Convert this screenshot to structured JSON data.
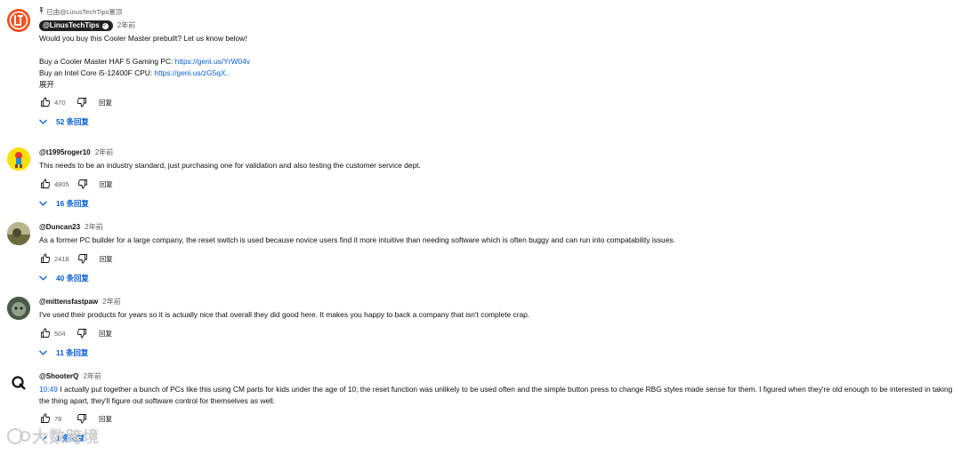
{
  "comments": [
    {
      "pinned_label": "已由@LinusTechTips置顶",
      "author": "@LinusTechTips",
      "time": "2年前",
      "lines": [
        "Would you buy this Cooler Master prebuilt? Let us know below!",
        "",
        "Buy a Cooler Master HAF 5 Gaming PC: ",
        "Buy an Intel Core i5-12400F CPU: "
      ],
      "links": [
        "https://geni.us/YrW04v",
        "https://geni.us/zG5qX.."
      ],
      "expand_label": "展开",
      "likes": "470",
      "reply_label": "回复",
      "replies_label": "52 条回复",
      "avatar_color": "#f4511e"
    },
    {
      "author": "@t1995roger10",
      "time": "2年前",
      "text": "This needs to be an industry standard, just purchasing one for validation and also testing the customer service dept.",
      "likes": "4805",
      "reply_label": "回复",
      "replies_label": "16 条回复",
      "avatar_color": "#f6e000"
    },
    {
      "author": "@Duncan23",
      "time": "2年前",
      "text": "As a former PC builder for a large company, the reset switch is used because novice users find it more intuitive than needing software which is often buggy and can run into compatability issues.",
      "likes": "2418",
      "reply_label": "回复",
      "replies_label": "40 条回复",
      "avatar_color": "#8a8a5c"
    },
    {
      "author": "@mittensfastpaw",
      "time": "2年前",
      "text": "I've used their products for years so it is actually nice that overall they did good here. It makes you happy to back a company that isn't complete crap.",
      "likes": "504",
      "reply_label": "回复",
      "replies_label": "11 条回复",
      "avatar_color": "#5c6e5a"
    },
    {
      "author": "@ShooterQ",
      "time": "2年前",
      "timestamp_link": "10:49",
      "text": " I actually put together a bunch of PCs like this using CM parts for kids under the age of 10; the reset function was unlikely to be used often and the simple button press to change RBG styles made sense for them. I figured when they're old enough to be interested in taking the thing apart, they'll figure out software control for themselves as well.",
      "likes": "78",
      "reply_label": "回复",
      "replies_label": "1 条回复",
      "avatar_color": "#ffffff"
    }
  ],
  "watermark": "大数跨境",
  "colors": {
    "link": "#065fd4",
    "muted": "#606060",
    "text": "#0f0f0f"
  }
}
